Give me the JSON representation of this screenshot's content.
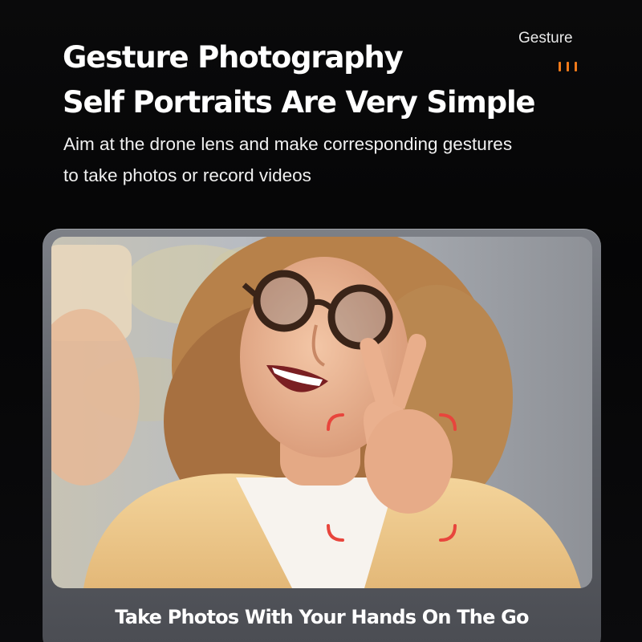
{
  "header": {
    "title_line1": "Gesture Photography",
    "title_line2": "Self Portraits Are Very Simple",
    "subtitle_line1": "Aim at the drone lens and make corresponding gestures",
    "subtitle_line2": "to take photos or record videos"
  },
  "badge": {
    "label": "Gesture",
    "accent_color": "#f07a1a"
  },
  "card": {
    "image_icon": "selfie-photo",
    "frame_color": "#e8453c",
    "caption": "Take Photos With Your Hands On The Go"
  }
}
